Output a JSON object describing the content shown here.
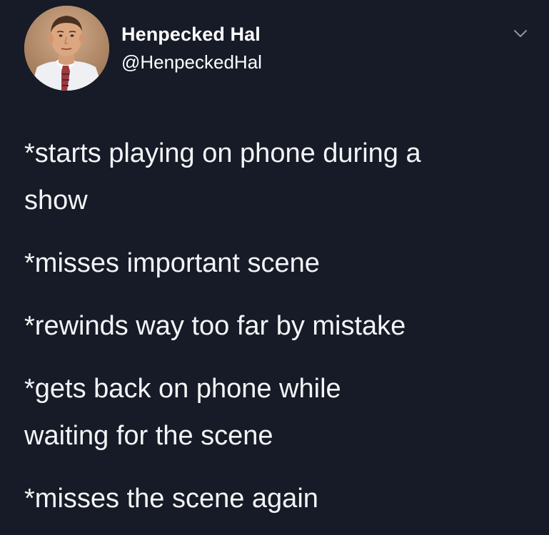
{
  "author": {
    "display_name": "Henpecked Hal",
    "handle": "@HenpeckedHal",
    "avatar_icon": "profile-photo"
  },
  "menu": {
    "icon": "chevron-down-icon"
  },
  "tweet": {
    "paragraphs": [
      [
        "*starts playing on phone during a",
        "show"
      ],
      [
        "*misses important scene"
      ],
      [
        "*rewinds way too far by mistake"
      ],
      [
        "*gets back on phone while",
        "waiting for the scene"
      ],
      [
        "*misses the scene again"
      ]
    ]
  },
  "colors": {
    "background": "#161b27",
    "text": "#f3f4f6",
    "muted": "#8b95a5"
  }
}
